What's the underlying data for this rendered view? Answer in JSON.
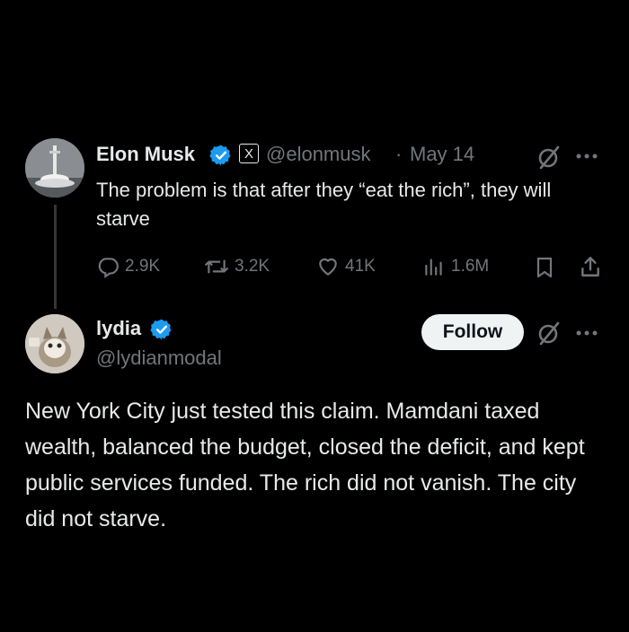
{
  "tweet1": {
    "name": "Elon Musk",
    "x_badge": "X",
    "handle": "@elonmusk",
    "separator": "·",
    "date": "May 14",
    "text": "The problem is that after they “eat the rich”, they will starve",
    "actions": {
      "replies": "2.9K",
      "reposts": "3.2K",
      "likes": "41K",
      "views": "1.6M"
    }
  },
  "tweet2": {
    "name": "lydia",
    "handle": "@lydianmodal",
    "follow_label": "Follow",
    "text": "New York City just tested this claim. Mamdani taxed wealth, balanced the budget, closed the deficit, and kept public services funded. The rich did not vanish. The city did not starve."
  },
  "colors": {
    "background": "#000000",
    "verified": "#1d9bf0",
    "muted": "#71767b"
  }
}
